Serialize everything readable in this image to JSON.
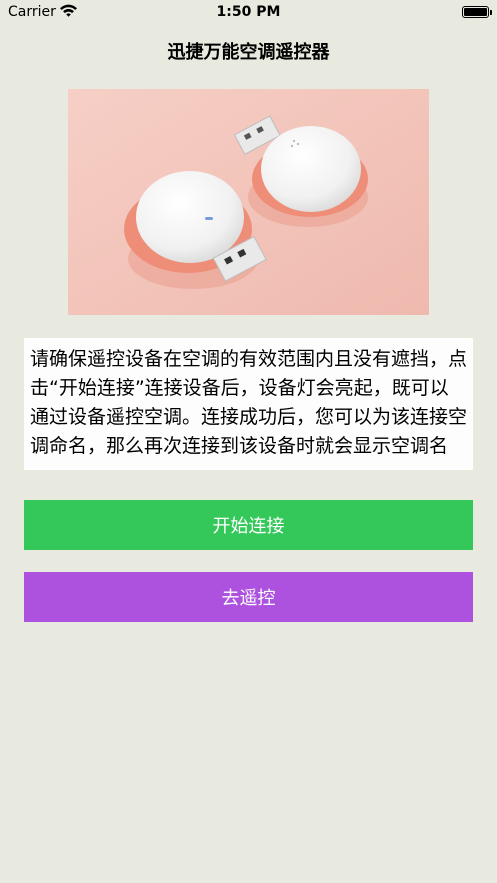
{
  "status_bar": {
    "carrier": "Carrier",
    "time": "1:50 PM"
  },
  "nav": {
    "title": "迅捷万能空调遥控器"
  },
  "content": {
    "description": "请确保遥控设备在空调的有效范围内且没有遮挡，点击“开始连接”连接设备后，设备灯会亮起，既可以通过设备遥控空调。连接成功后，您可以为该连接空调命名，那么再次连接到该设备时就会显示空调名"
  },
  "buttons": {
    "connect_label": "开始连接",
    "remote_label": "去遥控"
  },
  "colors": {
    "background": "#e8eadf",
    "connect_button": "#34c85a",
    "remote_button": "#ad52de",
    "hero_background": "#f3c4bb"
  },
  "icons": {
    "wifi": "wifi-icon",
    "battery": "battery-icon"
  }
}
